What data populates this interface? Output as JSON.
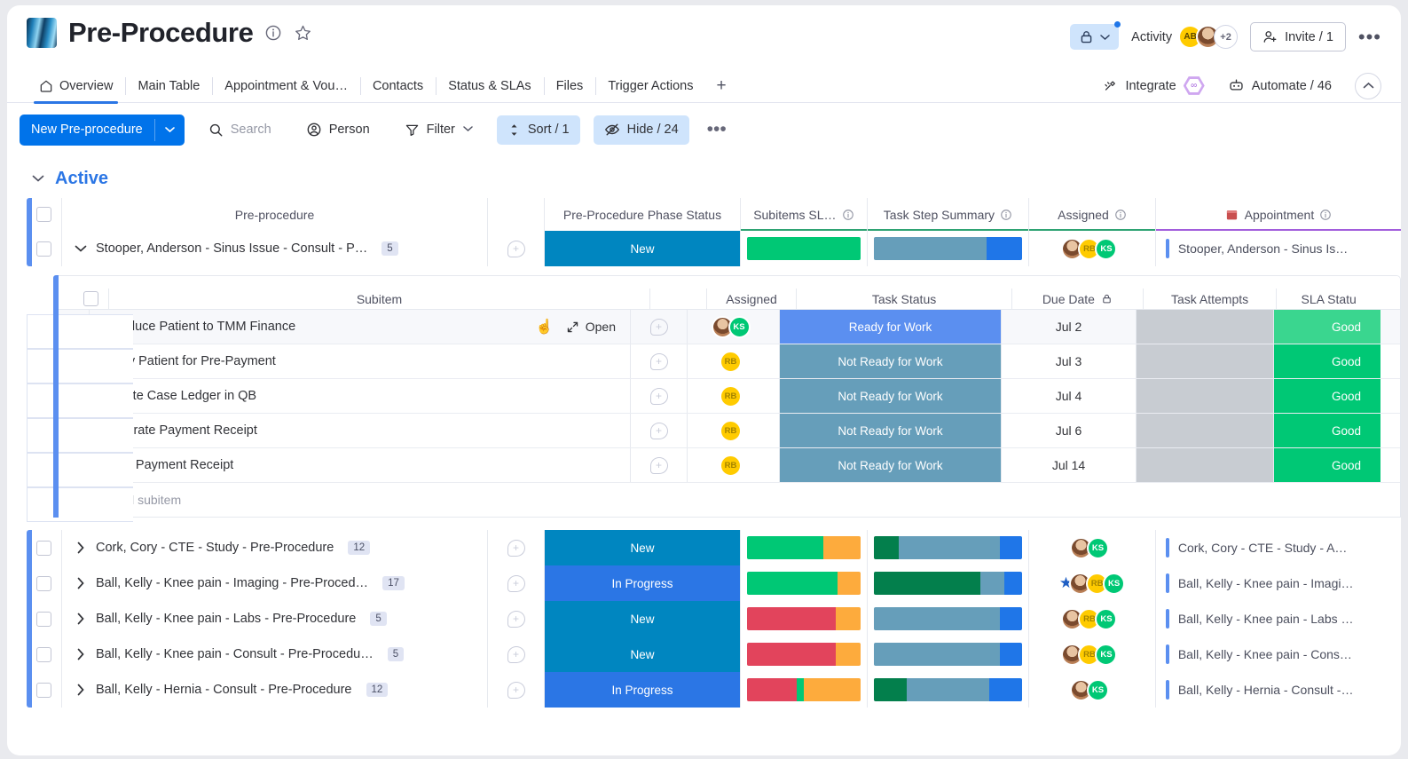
{
  "header": {
    "board_title": "Pre-Procedure",
    "info_icon": "info-icon",
    "favorite_icon": "star-outline-icon",
    "lock_icon": "lock-icon",
    "activity_label": "Activity",
    "activity_more": "+2",
    "invite_label": "Invite / 1",
    "more_label": "•••"
  },
  "tabs": {
    "items": [
      {
        "label": "Overview",
        "icon": "home-icon",
        "active": true
      },
      {
        "label": "Main Table",
        "active": false
      },
      {
        "label": "Appointment & Vou…",
        "active": false
      },
      {
        "label": "Contacts",
        "active": false
      },
      {
        "label": "Status & SLAs",
        "active": false
      },
      {
        "label": "Files",
        "active": false
      },
      {
        "label": "Trigger Actions",
        "active": false
      }
    ],
    "add_label": "+",
    "integrate_label": "Integrate",
    "automate_label": "Automate / 46"
  },
  "toolbar": {
    "new_label": "New Pre-procedure",
    "search_label": "Search",
    "person_label": "Person",
    "filter_label": "Filter",
    "sort_label": "Sort / 1",
    "hide_label": "Hide / 24",
    "more_label": "•••"
  },
  "group": {
    "name": "Active",
    "collapse_icon": "chevron-down-icon"
  },
  "main_table": {
    "columns": [
      {
        "label": "Pre-procedure",
        "info": false
      },
      {
        "label": "Pre-Procedure Phase Status",
        "info": false
      },
      {
        "label": "Subitems SL…",
        "info": true
      },
      {
        "label": "Task Step Summary",
        "info": true
      },
      {
        "label": "Assigned",
        "info": true
      },
      {
        "label": "Appointment",
        "info": true,
        "icon": "calendar-icon"
      }
    ],
    "rows": [
      {
        "name": "Stooper, Anderson - Sinus Issue - Consult - P…",
        "count": "5",
        "expanded": true,
        "status": "New",
        "status_color": "#0086c0",
        "sla_segments": [
          {
            "color": "#00c875",
            "pct": 100
          }
        ],
        "summary_segments": [
          {
            "color": "#669eba",
            "pct": 76
          },
          {
            "color": "#1f76e8",
            "pct": 24
          }
        ],
        "assigned": [
          "photo",
          "RB",
          "KS"
        ],
        "starred": false,
        "appointment": "Stooper, Anderson - Sinus Is…"
      },
      {
        "name": "Cork, Cory - CTE - Study - Pre-Procedure",
        "count": "12",
        "expanded": false,
        "status": "New",
        "status_color": "#0086c0",
        "sla_segments": [
          {
            "color": "#00c875",
            "pct": 67
          },
          {
            "color": "#fdab3d",
            "pct": 33
          }
        ],
        "summary_segments": [
          {
            "color": "#037f4c",
            "pct": 17
          },
          {
            "color": "#669eba",
            "pct": 68
          },
          {
            "color": "#1f76e8",
            "pct": 15
          }
        ],
        "assigned": [
          "photo",
          "KS"
        ],
        "starred": false,
        "appointment": "Cork, Cory - CTE - Study - A…"
      },
      {
        "name": "Ball, Kelly - Knee pain - Imaging - Pre-Proced…",
        "count": "17",
        "expanded": false,
        "status": "In Progress",
        "status_color": "#2b76e5",
        "sla_segments": [
          {
            "color": "#00c875",
            "pct": 80
          },
          {
            "color": "#fdab3d",
            "pct": 20
          }
        ],
        "summary_segments": [
          {
            "color": "#037f4c",
            "pct": 72
          },
          {
            "color": "#669eba",
            "pct": 16
          },
          {
            "color": "#1f76e8",
            "pct": 12
          }
        ],
        "assigned": [
          "photo",
          "RB",
          "KS"
        ],
        "starred": true,
        "appointment": "Ball, Kelly - Knee pain - Imagi…"
      },
      {
        "name": "Ball, Kelly - Knee pain - Labs - Pre-Procedure",
        "count": "5",
        "expanded": false,
        "status": "New",
        "status_color": "#0086c0",
        "sla_segments": [
          {
            "color": "#e2445c",
            "pct": 78
          },
          {
            "color": "#fdab3d",
            "pct": 22
          }
        ],
        "summary_segments": [
          {
            "color": "#669eba",
            "pct": 85
          },
          {
            "color": "#1f76e8",
            "pct": 15
          }
        ],
        "assigned": [
          "photo",
          "RB",
          "KS"
        ],
        "starred": false,
        "appointment": "Ball, Kelly - Knee pain - Labs …"
      },
      {
        "name": "Ball, Kelly - Knee pain - Consult - Pre-Procedu…",
        "count": "5",
        "expanded": false,
        "status": "New",
        "status_color": "#0086c0",
        "sla_segments": [
          {
            "color": "#e2445c",
            "pct": 78
          },
          {
            "color": "#fdab3d",
            "pct": 22
          }
        ],
        "summary_segments": [
          {
            "color": "#669eba",
            "pct": 85
          },
          {
            "color": "#1f76e8",
            "pct": 15
          }
        ],
        "assigned": [
          "photo",
          "RB",
          "KS"
        ],
        "starred": false,
        "appointment": "Ball, Kelly - Knee pain - Cons…"
      },
      {
        "name": "Ball, Kelly - Hernia - Consult - Pre-Procedure",
        "count": "12",
        "expanded": false,
        "status": "In Progress",
        "status_color": "#2b76e5",
        "sla_segments": [
          {
            "color": "#e2445c",
            "pct": 44
          },
          {
            "color": "#00c875",
            "pct": 6
          },
          {
            "color": "#fdab3d",
            "pct": 50
          }
        ],
        "summary_segments": [
          {
            "color": "#037f4c",
            "pct": 22
          },
          {
            "color": "#669eba",
            "pct": 56
          },
          {
            "color": "#1f76e8",
            "pct": 22
          }
        ],
        "assigned": [
          "photo",
          "KS"
        ],
        "starred": false,
        "appointment": "Ball, Kelly - Hernia - Consult -…"
      }
    ]
  },
  "subitem_table": {
    "columns": [
      {
        "label": "Subitem"
      },
      {
        "label": "Assigned"
      },
      {
        "label": "Task Status"
      },
      {
        "label": "Due Date",
        "icon": "lock-icon"
      },
      {
        "label": "Task Attempts"
      },
      {
        "label": "SLA Statu"
      }
    ],
    "open_label": "Open",
    "add_label": "+ Add subitem",
    "rows": [
      {
        "name": "Introduce Patient to TMM Finance",
        "hovered": true,
        "assigned": [
          "photo",
          "KS"
        ],
        "status": "Ready for Work",
        "status_color": "#5b8ff0",
        "due": "Jul 2",
        "attempts": "",
        "sla": "Good",
        "sla_color": "#3ad68f"
      },
      {
        "name": "Notify Patient for Pre-Payment",
        "hovered": false,
        "assigned": [
          "RB"
        ],
        "status": "Not Ready for Work",
        "status_color": "#669eba",
        "due": "Jul 3",
        "attempts": "",
        "sla": "Good",
        "sla_color": "#00c875"
      },
      {
        "name": "Update Case Ledger in QB",
        "hovered": false,
        "assigned": [
          "RB"
        ],
        "status": "Not Ready for Work",
        "status_color": "#669eba",
        "due": "Jul 4",
        "attempts": "",
        "sla": "Good",
        "sla_color": "#00c875"
      },
      {
        "name": "Generate Payment Receipt",
        "hovered": false,
        "assigned": [
          "RB"
        ],
        "status": "Not Ready for Work",
        "status_color": "#669eba",
        "due": "Jul 6",
        "attempts": "",
        "sla": "Good",
        "sla_color": "#00c875"
      },
      {
        "name": "Send Payment Receipt",
        "hovered": false,
        "assigned": [
          "RB"
        ],
        "status": "Not Ready for Work",
        "status_color": "#669eba",
        "due": "Jul 14",
        "attempts": "",
        "sla": "Good",
        "sla_color": "#00c875"
      }
    ]
  },
  "colors": {
    "primary_blue": "#0073ea",
    "accent_blue": "#5b8ff0",
    "status_new": "#0086c0",
    "status_in_progress": "#2b76e5",
    "green": "#00c875",
    "dark_green": "#037f4c",
    "orange": "#fdab3d",
    "red": "#e2445c",
    "steel": "#669eba",
    "group_green_underline": "#2ea373",
    "group_purple_underline": "#a25ddc"
  }
}
